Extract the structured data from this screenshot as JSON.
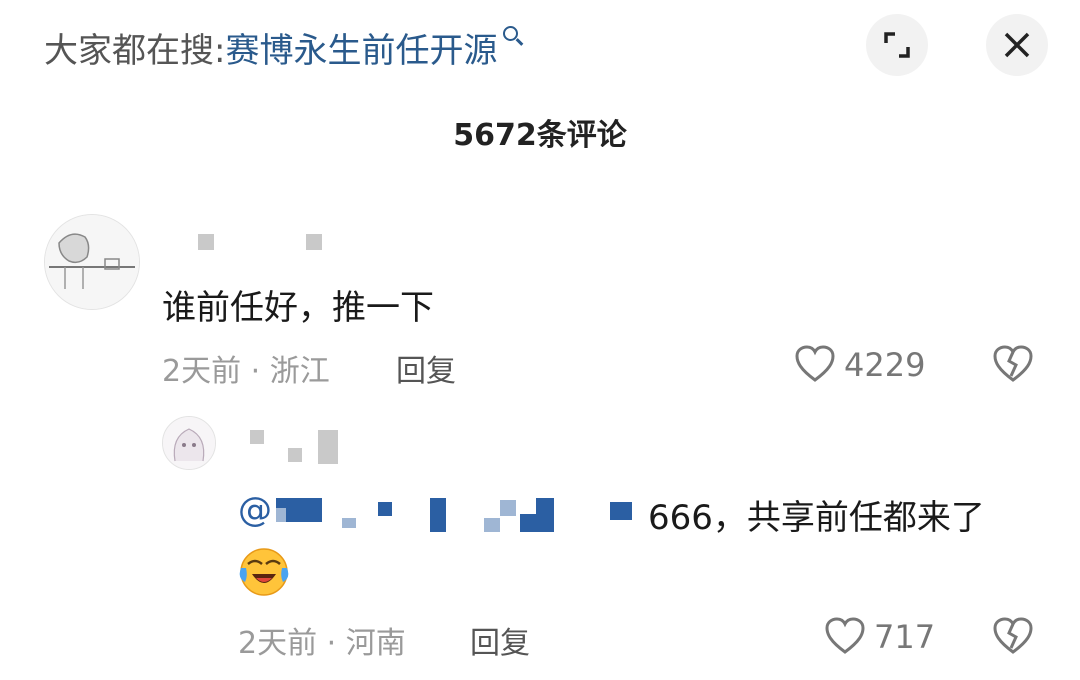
{
  "search": {
    "prefix": "大家都在搜:",
    "term": "赛博永生前任开源"
  },
  "header": {
    "comment_count": "5672条评论"
  },
  "comments": [
    {
      "text": "谁前任好，推一下",
      "time": "2天前",
      "location": "浙江",
      "reply_label": "回复",
      "likes": "4229"
    },
    {
      "mention": "@",
      "text": "666，共享前任都来了",
      "time": "2天前",
      "location": "河南",
      "reply_label": "回复",
      "likes": "717"
    }
  ],
  "separator": "·",
  "icons": {
    "search": "search-icon",
    "expand": "expand-icon",
    "close": "close-icon",
    "like": "heart-icon",
    "dislike": "broken-heart-icon",
    "emoji": "laughing-crying-emoji"
  },
  "colors": {
    "accent": "#2a5a8c",
    "mention": "#2b5fa3",
    "meta": "#9a9a9a"
  }
}
